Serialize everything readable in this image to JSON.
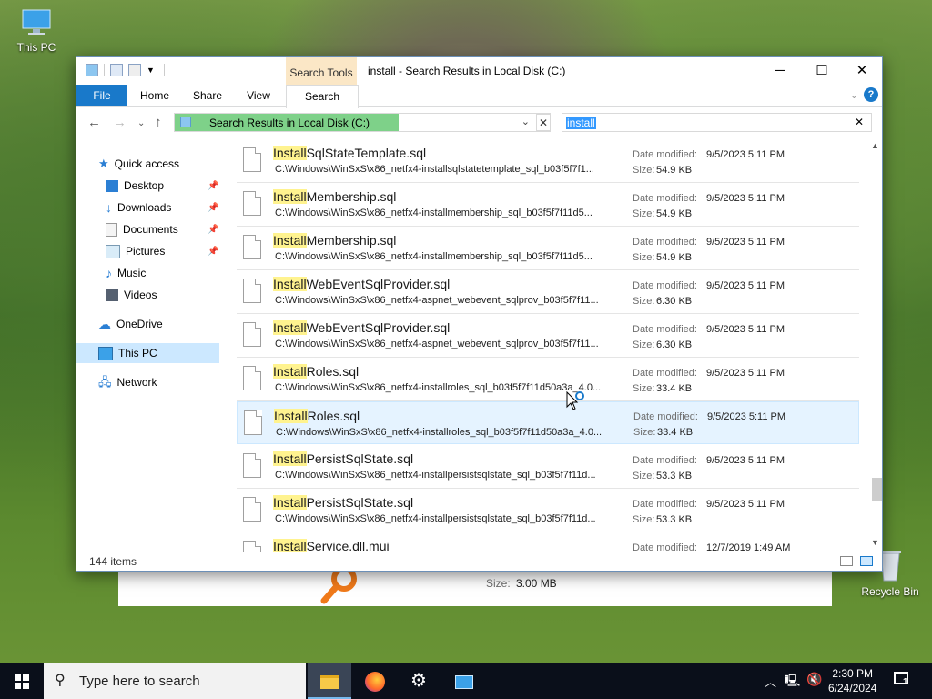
{
  "desktop": {
    "this_pc_label": "This PC",
    "recycle_bin_label": "Recycle Bin"
  },
  "window": {
    "title": "install - Search Results in Local Disk (C:)",
    "context_tab": "Search Tools",
    "ribbon_tabs": [
      "File",
      "Home",
      "Share",
      "View",
      "Search"
    ],
    "help": "?"
  },
  "address": {
    "path": "Search Results in Local Disk (C:)",
    "search_value": "install"
  },
  "nav": {
    "quick_access": "Quick access",
    "desktop": "Desktop",
    "downloads": "Downloads",
    "documents": "Documents",
    "pictures": "Pictures",
    "music": "Music",
    "videos": "Videos",
    "onedrive": "OneDrive",
    "this_pc": "This PC",
    "network": "Network"
  },
  "results": {
    "date_label": "Date modified:",
    "size_label": "Size:",
    "items": [
      {
        "hit": "Install",
        "rest": "SqlStateTemplate.sql",
        "path": "C:\\Windows\\WinSxS\\x86_netfx4-installsqlstatetemplate_sql_b03f5f7f1...",
        "date": "9/5/2023 5:11 PM",
        "size": "54.9 KB"
      },
      {
        "hit": "Install",
        "rest": "Membership.sql",
        "path": "C:\\Windows\\WinSxS\\x86_netfx4-installmembership_sql_b03f5f7f11d5...",
        "date": "9/5/2023 5:11 PM",
        "size": "54.9 KB"
      },
      {
        "hit": "Install",
        "rest": "Membership.sql",
        "path": "C:\\Windows\\WinSxS\\x86_netfx4-installmembership_sql_b03f5f7f11d5...",
        "date": "9/5/2023 5:11 PM",
        "size": "54.9 KB"
      },
      {
        "hit": "Install",
        "rest": "WebEventSqlProvider.sql",
        "path": "C:\\Windows\\WinSxS\\x86_netfx4-aspnet_webevent_sqlprov_b03f5f7f11...",
        "date": "9/5/2023 5:11 PM",
        "size": "6.30 KB"
      },
      {
        "hit": "Install",
        "rest": "WebEventSqlProvider.sql",
        "path": "C:\\Windows\\WinSxS\\x86_netfx4-aspnet_webevent_sqlprov_b03f5f7f11...",
        "date": "9/5/2023 5:11 PM",
        "size": "6.30 KB"
      },
      {
        "hit": "Install",
        "rest": "Roles.sql",
        "path": "C:\\Windows\\WinSxS\\x86_netfx4-installroles_sql_b03f5f7f11d50a3a_4.0...",
        "date": "9/5/2023 5:11 PM",
        "size": "33.4 KB"
      },
      {
        "hit": "Install",
        "rest": "Roles.sql",
        "path": "C:\\Windows\\WinSxS\\x86_netfx4-installroles_sql_b03f5f7f11d50a3a_4.0...",
        "date": "9/5/2023 5:11 PM",
        "size": "33.4 KB"
      },
      {
        "hit": "Install",
        "rest": "PersistSqlState.sql",
        "path": "C:\\Windows\\WinSxS\\x86_netfx4-installpersistsqlstate_sql_b03f5f7f11d...",
        "date": "9/5/2023 5:11 PM",
        "size": "53.3 KB"
      },
      {
        "hit": "Install",
        "rest": "PersistSqlState.sql",
        "path": "C:\\Windows\\WinSxS\\x86_netfx4-installpersistsqlstate_sql_b03f5f7f11d...",
        "date": "9/5/2023 5:11 PM",
        "size": "53.3 KB"
      },
      {
        "hit": "Install",
        "rest": "Service.dll.mui",
        "path": "",
        "date": "12/7/2019 1:49 AM",
        "size": ""
      }
    ]
  },
  "status": {
    "items_count": "144 items"
  },
  "behind_window": {
    "size_label": "Size:",
    "size_value": "3.00 MB"
  },
  "taskbar": {
    "search_placeholder": "Type here to search",
    "time": "2:30 PM",
    "date": "6/24/2024",
    "notification_count": "1"
  },
  "colors": {
    "accent": "#1979ca",
    "address_fill": "#7ed189",
    "hit_highlight": "#fff38f",
    "selection": "#e5f3ff",
    "taskbar": "#0a0f1a"
  }
}
